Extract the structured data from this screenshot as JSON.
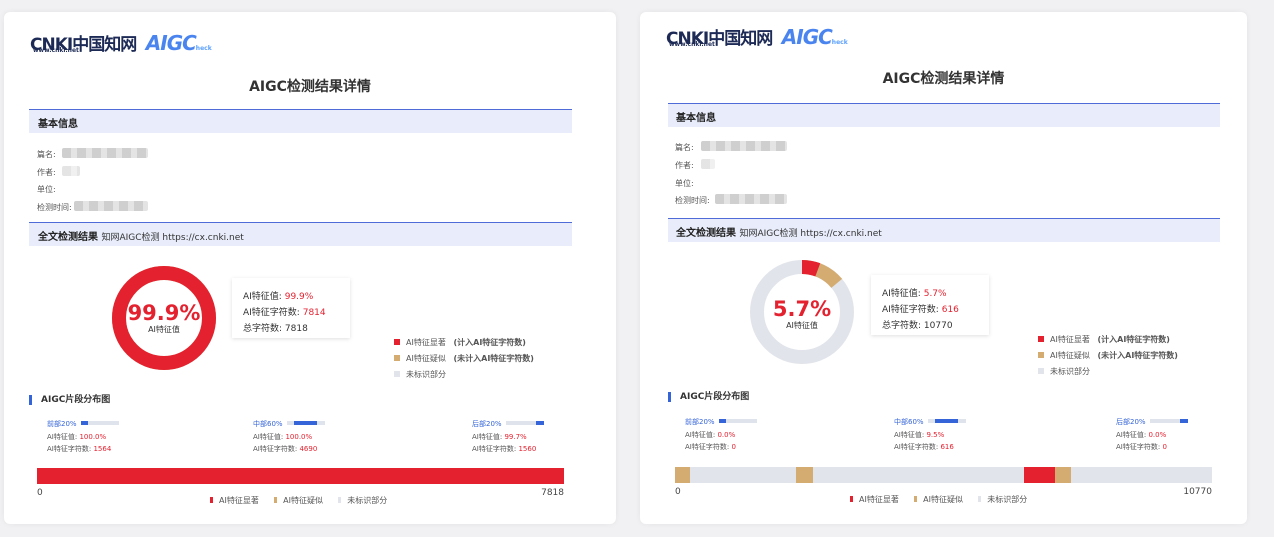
{
  "colors": {
    "significant": "#e4212f",
    "suspected": "#d4ac72",
    "unmarked": "#e1e4ea",
    "accent": "#3564d8"
  },
  "reports": [
    {
      "logo": {
        "cnki": "CNKI中国知网",
        "cnki_sub": "www.cnki.net",
        "aigc": "AIGC",
        "heck": "heck"
      },
      "title": "AIGC检测结果详情",
      "basic": {
        "heading": "基本信息",
        "name_label": "篇名:",
        "author_label": "作者:",
        "unit_label": "单位:",
        "time_label": "检测时间:"
      },
      "result": {
        "heading": "全文检测结果",
        "sub": "知网AIGC检测  https://cx.cnki.net"
      },
      "ring": {
        "percent_text": "99.9%",
        "caption": "AI特征值",
        "significant_fraction": 0.999,
        "suspected_fraction": 0.0
      },
      "stats": {
        "ai_value_label": "AI特征值:",
        "ai_value": "99.9%",
        "ai_chars_label": "AI特征字符数:",
        "ai_chars": "7814",
        "total_label": "总字符数:",
        "total": "7818"
      },
      "legend": {
        "significant": "AI特征显著",
        "significant_note": "(计入AI特征字符数)",
        "suspected": "AI特征疑似",
        "suspected_note": "(未计入AI特征字符数)",
        "unmarked": "未标识部分"
      },
      "segments_title": "AIGC片段分布图",
      "segments": [
        {
          "label": "前部20%",
          "value_label": "AI特征值:",
          "value": "100.0%",
          "chars_label": "AI特征字符数:",
          "chars": "1564",
          "bar_fraction": 0.2,
          "bar_offset": 0.0
        },
        {
          "label": "中部60%",
          "value_label": "AI特征值:",
          "value": "100.0%",
          "chars_label": "AI特征字符数:",
          "chars": "4690",
          "bar_fraction": 0.6,
          "bar_offset": 0.2
        },
        {
          "label": "后部20%",
          "value_label": "AI特征值:",
          "value": "99.7%",
          "chars_label": "AI特征字符数:",
          "chars": "1560",
          "bar_fraction": 0.2,
          "bar_offset": 0.8
        }
      ],
      "distribution": {
        "start": "0",
        "end": "7818",
        "total": 7818,
        "blocks": [
          {
            "from": 0,
            "to": 7818,
            "kind": "significant"
          }
        ]
      },
      "bottom_legend": {
        "significant": "AI特征显著",
        "suspected": "AI特征疑似",
        "unmarked": "未标识部分"
      }
    },
    {
      "logo": {
        "cnki": "CNKI中国知网",
        "cnki_sub": "www.cnki.net",
        "aigc": "AIGC",
        "heck": "heck"
      },
      "title": "AIGC检测结果详情",
      "basic": {
        "heading": "基本信息",
        "name_label": "篇名:",
        "author_label": "作者:",
        "unit_label": "单位:",
        "time_label": "检测时间:"
      },
      "result": {
        "heading": "全文检测结果",
        "sub": "知网AIGC检测  https://cx.cnki.net"
      },
      "ring": {
        "percent_text": "5.7%",
        "caption": "AI特征值",
        "significant_fraction": 0.057,
        "suspected_fraction": 0.083
      },
      "stats": {
        "ai_value_label": "AI特征值:",
        "ai_value": "5.7%",
        "ai_chars_label": "AI特征字符数:",
        "ai_chars": "616",
        "total_label": "总字符数:",
        "total": "10770"
      },
      "legend": {
        "significant": "AI特征显著",
        "significant_note": "(计入AI特征字符数)",
        "suspected": "AI特征疑似",
        "suspected_note": "(未计入AI特征字符数)",
        "unmarked": "未标识部分"
      },
      "segments_title": "AIGC片段分布图",
      "segments": [
        {
          "label": "前部20%",
          "value_label": "AI特征值:",
          "value": "0.0%",
          "chars_label": "AI特征字符数:",
          "chars": "0",
          "bar_fraction": 0.2,
          "bar_offset": 0.0
        },
        {
          "label": "中部60%",
          "value_label": "AI特征值:",
          "value": "9.5%",
          "chars_label": "AI特征字符数:",
          "chars": "616",
          "bar_fraction": 0.6,
          "bar_offset": 0.2
        },
        {
          "label": "后部20%",
          "value_label": "AI特征值:",
          "value": "0.0%",
          "chars_label": "AI特征字符数:",
          "chars": "0",
          "bar_fraction": 0.2,
          "bar_offset": 0.8
        }
      ],
      "distribution": {
        "start": "0",
        "end": "10770",
        "total": 10770,
        "blocks": [
          {
            "from": 0,
            "to": 300,
            "kind": "suspected"
          },
          {
            "from": 2430,
            "to": 2760,
            "kind": "suspected"
          },
          {
            "from": 7000,
            "to": 7616,
            "kind": "significant"
          },
          {
            "from": 7616,
            "to": 7950,
            "kind": "suspected"
          }
        ]
      },
      "bottom_legend": {
        "significant": "AI特征显著",
        "suspected": "AI特征疑似",
        "unmarked": "未标识部分"
      }
    }
  ]
}
